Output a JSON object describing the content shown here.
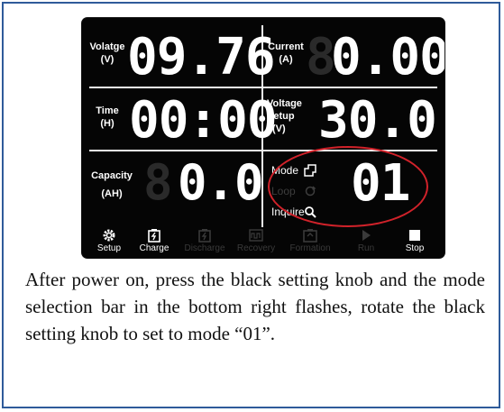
{
  "device": {
    "panels": {
      "voltage": {
        "label_line1": "Volatge",
        "label_line2": "(V)",
        "value": "09.76",
        "ghost": ""
      },
      "current": {
        "label_line1": "Current",
        "label_line2": "(A)",
        "value": "0.00",
        "ghost": "8"
      },
      "time": {
        "label_line1": "Time",
        "label_line2": "(H)",
        "value": "00:00"
      },
      "voltage_setup": {
        "label_line1": "Voltage",
        "label_line2": "Setup",
        "label_line3": "(V)",
        "value": "30.0"
      },
      "capacity": {
        "label_line1": "Capacity",
        "label_line2": "(AH)",
        "value": "0.0",
        "ghost": "8"
      }
    },
    "mode_list": {
      "mode": "Mode",
      "loop": "Loop",
      "inquire": "Inquire"
    },
    "mode_value": "01",
    "bottom_bar": [
      {
        "label": "Setup",
        "active": true
      },
      {
        "label": "Charge",
        "active": true
      },
      {
        "label": "Discharge",
        "active": false
      },
      {
        "label": "Recovery",
        "active": false
      },
      {
        "label": "Formation",
        "active": false
      },
      {
        "label": "Run",
        "active": false
      },
      {
        "label": "Stop",
        "active": true
      }
    ],
    "highlight_color": "#d1222a"
  },
  "caption": {
    "text": "After power on, press the black setting knob and the mode selection bar in the bottom right flashes, rotate the black setting knob to set to mode “01”."
  }
}
